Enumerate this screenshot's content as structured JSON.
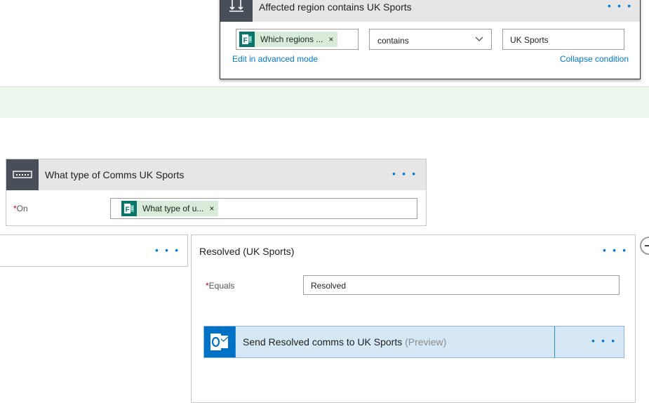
{
  "condition": {
    "title": "Affected region contains UK Sports",
    "menu": "• • •",
    "left_token": "Which regions ...",
    "token_remove": "×",
    "operator": "contains",
    "value": "UK Sports",
    "edit_advanced": "Edit in advanced mode",
    "collapse": "Collapse condition"
  },
  "switch": {
    "title": "What type of Comms UK Sports",
    "menu": "• • •",
    "on_required": "*",
    "on_label": "On",
    "on_token": "What type of u...",
    "token_remove": "×"
  },
  "cases": {
    "left_menu": "• • •",
    "right": {
      "title": "Resolved (UK Sports)",
      "menu": "• • •",
      "equals_required": "*",
      "equals_label": "Equals",
      "equals_value": "Resolved",
      "action_title": "Send Resolved comms to UK Sports",
      "action_preview": "(Preview)",
      "action_menu": "• • •"
    }
  },
  "icons": {
    "condition": "condition-icon",
    "switch": "switch-icon",
    "forms": "microsoft-forms-icon",
    "outlook": "outlook-icon",
    "collapse": "minus-circle-icon"
  },
  "colors": {
    "accent": "#0078d4",
    "card_header": "#e6e6e6",
    "icon_box": "#484f58",
    "forms_green": "#077568",
    "token_bg": "#d9ecd9",
    "outlook_blue": "#0072c6",
    "band": "#eef7ee"
  }
}
